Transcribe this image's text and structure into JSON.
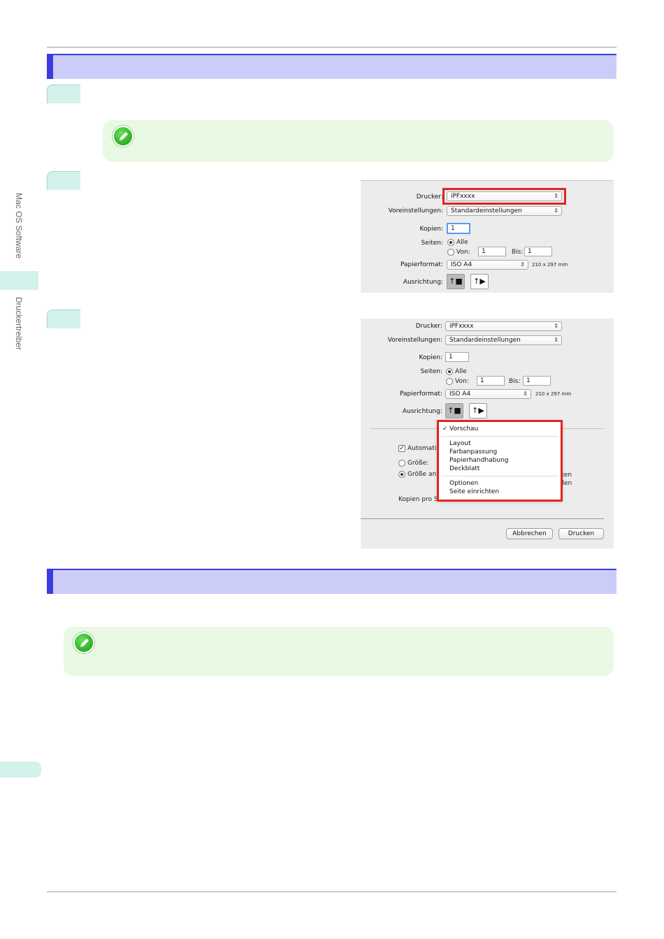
{
  "sidebar": {
    "tab_top": "Mac OS Software",
    "tab_bottom": "Druckertreiber"
  },
  "dialog1": {
    "printer_label": "Drucker:",
    "printer_value": "iPFxxxx",
    "presets_label": "Voreinstellungen:",
    "presets_value": "Standardeinstellungen",
    "copies_label": "Kopien:",
    "copies_value": "1",
    "pages_label": "Seiten:",
    "pages_all": "Alle",
    "pages_from": "Von:",
    "from_value": "1",
    "to_label": "Bis:",
    "to_value": "1",
    "paper_label": "Papierformat:",
    "paper_value": "ISO A4",
    "paper_size": "210 x 297 mm",
    "orientation_label": "Ausrichtung:"
  },
  "dialog2": {
    "printer_label": "Drucker:",
    "printer_value": "iPFxxxx",
    "presets_label": "Voreinstellungen:",
    "presets_value": "Standardeinstellungen",
    "copies_label": "Kopien:",
    "copies_value": "1",
    "pages_label": "Seiten:",
    "pages_all": "Alle",
    "pages_from": "Von:",
    "from_value": "1",
    "to_label": "Bis:",
    "to_value": "1",
    "paper_label": "Papierformat:",
    "paper_value": "ISO A4",
    "paper_size": "210 x 297 mm",
    "orientation_label": "Ausrichtung:",
    "auto_label": "Automatis",
    "size_label": "Größe:",
    "fit_label": "Größe an",
    "copies_per_sheet": "Kopien pro Seite:",
    "right_frag_1": "ken",
    "right_frag_2": "llen",
    "cancel_button": "Abbrechen",
    "print_button": "Drucken",
    "menu": {
      "checked": "Vorschau",
      "group1": [
        "Layout",
        "Farbanpassung",
        "Papierhandhabung",
        "Deckblatt"
      ],
      "group2": [
        "Optionen",
        "Seite einrichten"
      ]
    }
  },
  "colors": {
    "section_bar": "#ccccf8",
    "section_accent": "#3b3be0",
    "step_tab": "#d4f2ec",
    "note_bg": "#e9f9e3",
    "highlight": "#e02424"
  }
}
